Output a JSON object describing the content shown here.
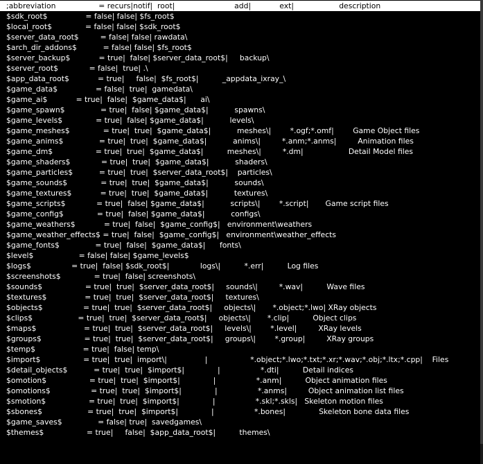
{
  "lines": [
    ";abbreviation                  = recurs|notif|  root|                         add|            ext|                   description",
    "$sdk_root$                = false| false| $fs_root$",
    "$local_root$              = false| false| $sdk_root$",
    "$server_data_root$         = false| false| rawdata\\",
    "$arch_dir_addons$           = false| false| $fs_root$",
    "$server_backup$            = true|  false| $server_data_root$|     backup\\",
    "$server_root$             = false|  true| .\\",
    "$app_data_root$            = true|     false|  $fs_root$|          _appdata_ixray_\\",
    "$game_data$                = false|  true|  gamedata\\",
    "$game_ai$            = true|  false|  $game_data$|      ai\\",
    "$game_spawn$               = true|  false| $game_data$|           spawns\\",
    "$game_levels$              = true|  false| $game_data$|           levels\\",
    "$game_meshes$              = true|  true|  $game_data$|           meshes\\|        *.ogf;*.omf|        Game Object files",
    "$game_anims$               = true|  true|  $game_data$|           anims\\|         *.anm;*.anms|         Animation files",
    "$game_dm$                  = true|  true|  $game_data$|          meshes\\|         *.dm|                   Detail Model files",
    "$game_shaders$             = true|  true|  $game_data$|           shaders\\",
    "$game_particles$           = true|  true|  $server_data_root$|    particles\\",
    "$game_sounds$              = true|  true|  $game_data$|           sounds\\",
    "$game_textures$            = true|  true|  $game_data$|           textures\\",
    "$game_scripts$             = true|  false| $game_data$|           scripts\\|        *.script|       Game script files",
    "$game_config$              = true|  false| $game_data$|           configs\\",
    "$game_weathers$            = true|  false|  $game_config$|   environment\\weathers",
    "$game_weather_effects$ = true|  false|  $game_config$|   environment\\weather_effects",
    "$game_fonts$               = true|  false|  $game_data$|      fonts\\",
    "$level$                   = false| false| $game_levels$",
    "$logs$                 = true|  false| $sdk_root$|             logs\\|          *.err|          Log files",
    "$screenshots$              = true|  false| screenshots\\",
    "$sounds$                  = true|  true|  $server_data_root$|     sounds\\|         *.wav|          Wave files",
    "$textures$                = true|  true|  $server_data_root$|     textures\\",
    "$objects$                 = true|  true|  $server_data_root$|     objects\\|       *.object;*.lwo| XRay objects",
    "$clips$                   = true|  true|  $server_data_root$|     objects\\|       *.clip|          Object clips",
    "$maps$                    = true|  true|  $server_data_root$|     levels\\|        *.level|         XRay levels",
    "$groups$                  = true|  true|  $server_data_root$|     groups\\|        *.group|         XRay groups",
    "$temp$                    = true|  false| temp\\",
    "$import$                  = true|  true|  import\\|                |                  *.object;*.lwo;*.txt;*.xr;*.wav;*.obj;*.ltx;*.cpp|    Files",
    "$detail_objects$           = true|  true|  $import$|              |                 *.dti|          Detail indices",
    "$omotion$                  = true|  true|  $import$|              |                 *.anm|          Object animation files",
    "$omotions$                 = true|  true|  $import$|              |                 *.anms|         Object animation list files",
    "$smotion$                  = true|  true|  $import$|              |                 *.skl;*.skls|   Skeleton motion files",
    "$sbones$                   = true|  true|  $import$|              |                 *.bones|              Skeleton bone data files",
    "$game_saves$               = false| true|  savedgames\\",
    "$themes$                  = true|     false|  $app_data_root$|          themes\\"
  ]
}
